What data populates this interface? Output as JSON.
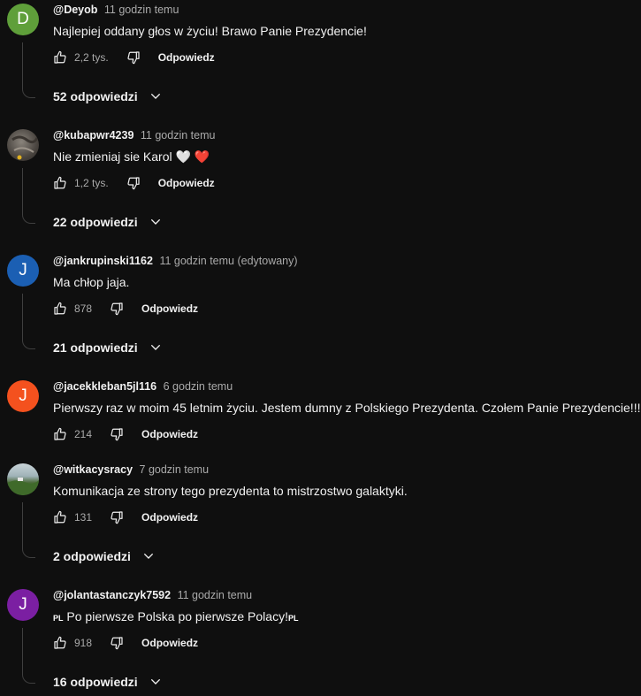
{
  "reply_label": "Odpowiedz",
  "comments": [
    {
      "author": "@Deyob",
      "time": "11 godzin temu",
      "text": "Najlepiej oddany głos w życiu! Brawo Panie Prezydencie!",
      "likes": "2,2 tys.",
      "replies": "52 odpowiedzi",
      "avatar_letter": "D",
      "avatar_color": "#5f9f3a"
    },
    {
      "author": "@kubapwr4239",
      "time": "11 godzin temu",
      "text": "Nie zmieniaj sie Karol 🤍 ❤️",
      "likes": "1,2 tys.",
      "replies": "22 odpowiedzi",
      "avatar_letter": "",
      "avatar_color": "#5a5550"
    },
    {
      "author": "@jankrupinski1162",
      "time": "11 godzin temu (edytowany)",
      "text": "Ma chłop jaja.",
      "likes": "878",
      "replies": "21 odpowiedzi",
      "avatar_letter": "J",
      "avatar_color": "#1b5fb3"
    },
    {
      "author": "@jacekkleban5jl116",
      "time": "6 godzin temu",
      "text": "Pierwszy raz w moim 45 letnim życiu. Jestem dumny z Polskiego Prezydenta.  Czołem Panie Prezydencie!!!",
      "likes": "214",
      "replies": "",
      "avatar_letter": "J",
      "avatar_color": "#f4511e"
    },
    {
      "author": "@witkacysracy",
      "time": "7 godzin temu",
      "text": "Komunikacja ze strony tego prezydenta to mistrzostwo galaktyki.",
      "likes": "131",
      "replies": "2 odpowiedzi",
      "avatar_letter": "",
      "avatar_color": "#6b7d5a"
    },
    {
      "author": "@jolantastanczyk7592",
      "time": "11 godzin temu",
      "text_prefix": "PL",
      "text": " Po pierwsze Polska po pierwsze Polacy!",
      "text_suffix": "PL",
      "likes": "918",
      "replies": "16 odpowiedzi",
      "avatar_letter": "J",
      "avatar_color": "#7b1fa2"
    }
  ]
}
